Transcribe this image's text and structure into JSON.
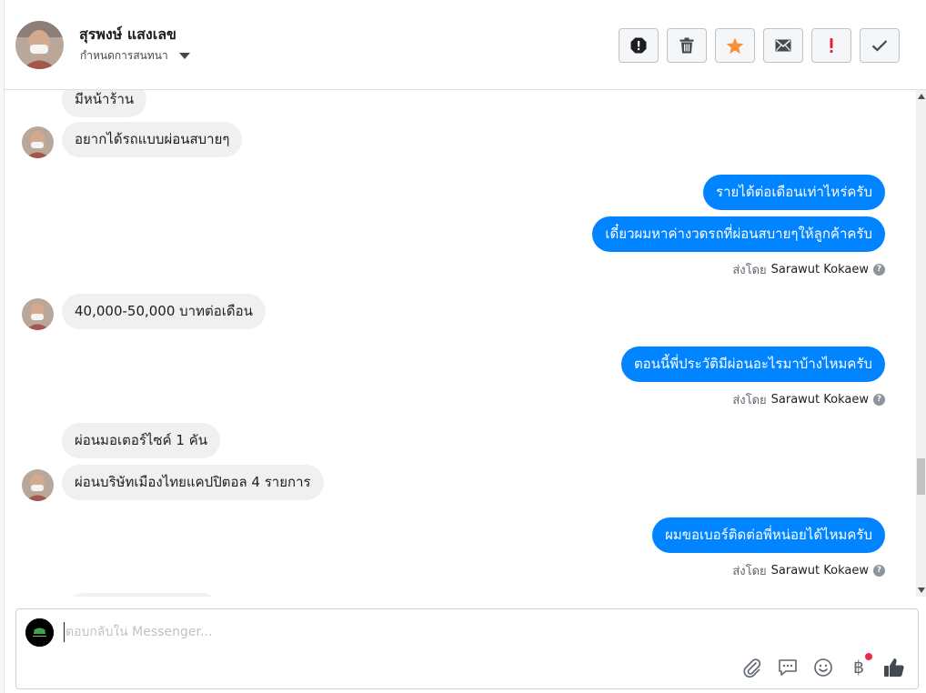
{
  "header": {
    "contact_name": "สุรพงษ์ แสงเลข",
    "assign_label": "กำหนดการสนทนา",
    "toolbar": [
      {
        "name": "spam-button",
        "icon": "alert-octagon-icon"
      },
      {
        "name": "delete-button",
        "icon": "trash-icon"
      },
      {
        "name": "star-button",
        "icon": "star-icon",
        "color": "#f7923b"
      },
      {
        "name": "mark-unread-button",
        "icon": "envelope-icon"
      },
      {
        "name": "follow-up-button",
        "icon": "exclamation-icon",
        "color": "#e41e3f"
      },
      {
        "name": "mark-done-button",
        "icon": "check-icon"
      }
    ]
  },
  "messages": [
    {
      "dir": "in",
      "text": "มีหน้าร้าน"
    },
    {
      "dir": "in",
      "text": "อยากได้รถแบบผ่อนสบายๆ"
    },
    {
      "dir": "out",
      "text": "รายได้ต่อเดือนเท่าไหร่ครับ"
    },
    {
      "dir": "out",
      "text": "เดี๋ยวผมหาค่างวดรถที่ผ่อนสบายๆให้ลูกค้าครับ"
    },
    {
      "dir": "in",
      "text": "40,000-50,000 บาทต่อเดือน"
    },
    {
      "dir": "out",
      "text": "ตอนนี้พี่ประวัติมีผ่อนอะไรมาบ้างไหมครับ"
    },
    {
      "dir": "in",
      "text": "ผ่อนมอเตอร์ไซค์ 1 คัน"
    },
    {
      "dir": "in",
      "text": "ผ่อนบริษัทเมืองไทยแคปปิตอล 4 รายการ"
    },
    {
      "dir": "out",
      "text": "ผมขอเบอร์ติดต่อพี่หน่อยได้ไหมครับ"
    }
  ],
  "sent_by": {
    "prefix": "ส่งโดย",
    "agent": "Sarawut Kokaew"
  },
  "composer": {
    "placeholder": "ตอบกลับใน Messenger...",
    "value": "",
    "baht_symbol": "฿",
    "tools": [
      "paperclip-icon",
      "speech-bubble-icon",
      "smiley-icon",
      "baht-icon",
      "thumbs-up-icon"
    ]
  },
  "colors": {
    "outgoing_bubble": "#0084ff",
    "incoming_bubble": "#f0f0f0",
    "notification_dot": "#f02849"
  }
}
